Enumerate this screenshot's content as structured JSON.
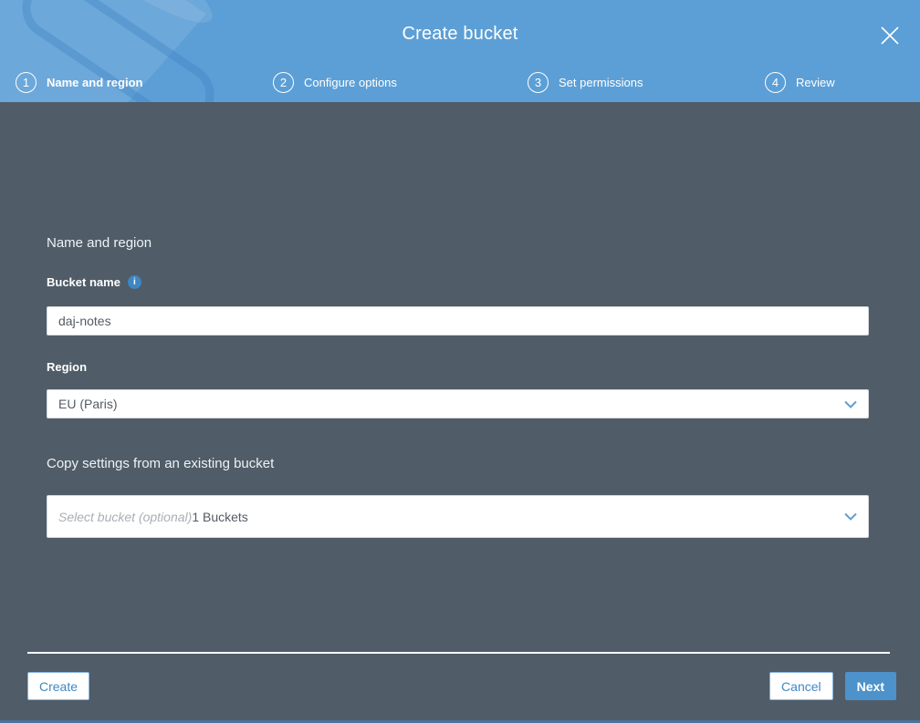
{
  "modal": {
    "title": "Create bucket",
    "steps": [
      {
        "number": "1",
        "label": "Name and region",
        "active": true
      },
      {
        "number": "2",
        "label": "Configure options",
        "active": false
      },
      {
        "number": "3",
        "label": "Set permissions",
        "active": false
      },
      {
        "number": "4",
        "label": "Review",
        "active": false
      }
    ]
  },
  "form": {
    "section_title": "Name and region",
    "bucket_name": {
      "label": "Bucket name",
      "value": "daj-notes",
      "info_icon": "i"
    },
    "region": {
      "label": "Region",
      "selected_value": "EU (Paris)"
    },
    "copy_settings": {
      "title": "Copy settings from an existing bucket",
      "placeholder": "Select bucket (optional)",
      "bucket_count": "1 Buckets"
    }
  },
  "footer": {
    "create_label": "Create",
    "cancel_label": "Cancel",
    "next_label": "Next"
  },
  "colors": {
    "header_blue": "#5C9FD6",
    "body_background": "#505C68",
    "accent_blue": "#3F88C5",
    "next_button_background": "#4D92CB",
    "info_icon_blue": "#3E87C3",
    "input_text": "#545B64",
    "placeholder_gray": "#A9AEB5"
  }
}
